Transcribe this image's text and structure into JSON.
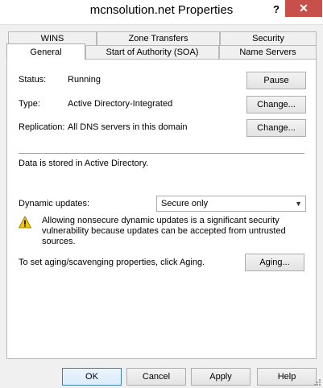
{
  "window": {
    "title": "mcnsolution.net Properties",
    "help_glyph": "?",
    "close_glyph": "✕"
  },
  "tabs_row_back": [
    "WINS",
    "Zone Transfers",
    "Security"
  ],
  "tabs_row_front": [
    "General",
    "Start of Authority (SOA)",
    "Name Servers"
  ],
  "active_tab": "General",
  "general": {
    "status_label": "Status:",
    "status_value": "Running",
    "pause_button": "Pause",
    "type_label": "Type:",
    "type_value": "Active Directory-Integrated",
    "type_change_button": "Change...",
    "replication_label": "Replication:",
    "replication_value": "All DNS servers in this domain",
    "replication_change_button": "Change...",
    "stored_text": "Data is stored in Active Directory.",
    "dynamic_updates_label": "Dynamic updates:",
    "dynamic_updates_value": "Secure only",
    "warning_text": "Allowing nonsecure dynamic updates is a significant security vulnerability because updates can be accepted from untrusted sources.",
    "aging_text": "To set aging/scavenging properties, click Aging.",
    "aging_button": "Aging..."
  },
  "footer": {
    "ok": "OK",
    "cancel": "Cancel",
    "apply": "Apply",
    "help": "Help"
  },
  "colors": {
    "close_button": "#c7504b",
    "dialog_bg": "#f0f0f0",
    "default_button_border": "#3c7fb1"
  }
}
